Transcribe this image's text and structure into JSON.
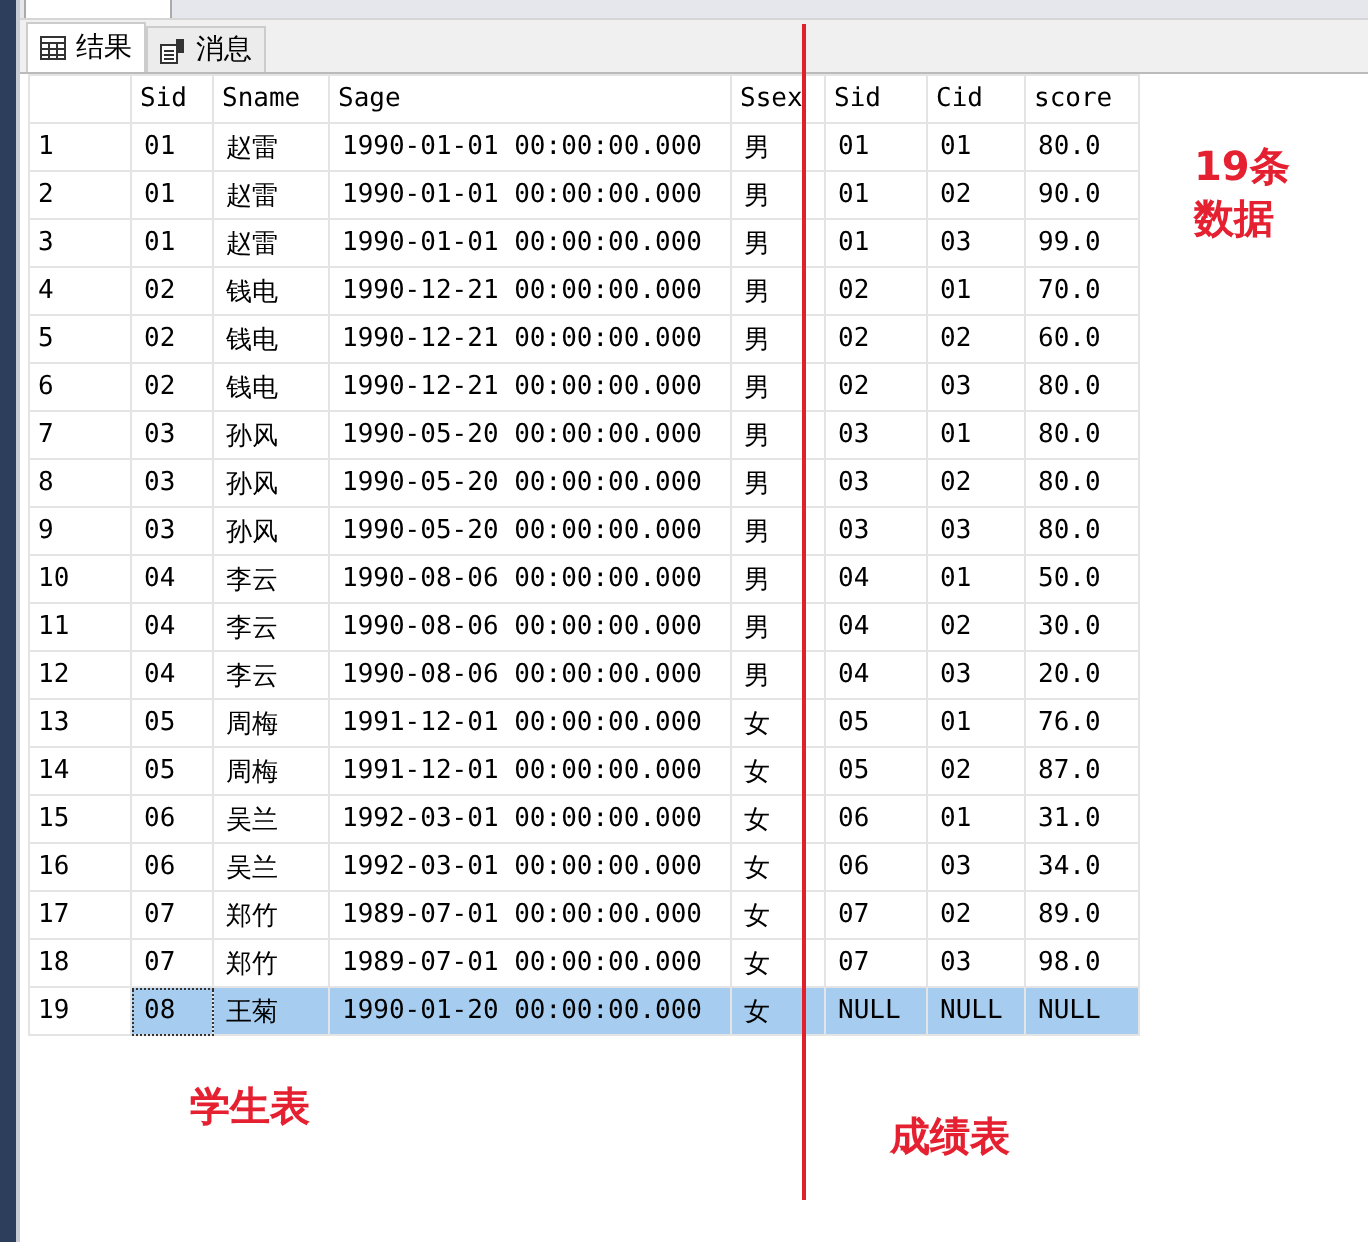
{
  "tabs": [
    {
      "label": "结果",
      "selected": true
    },
    {
      "label": "消息",
      "selected": false
    }
  ],
  "table": {
    "columns": [
      "",
      "Sid",
      "Sname",
      "Sage",
      "Ssex",
      "Sid",
      "Cid",
      "score"
    ],
    "rows": [
      {
        "cells": [
          "1",
          "01",
          "赵雷",
          "1990-01-01 00:00:00.000",
          "男",
          "01",
          "01",
          "80.0"
        ],
        "selected": false
      },
      {
        "cells": [
          "2",
          "01",
          "赵雷",
          "1990-01-01 00:00:00.000",
          "男",
          "01",
          "02",
          "90.0"
        ],
        "selected": false
      },
      {
        "cells": [
          "3",
          "01",
          "赵雷",
          "1990-01-01 00:00:00.000",
          "男",
          "01",
          "03",
          "99.0"
        ],
        "selected": false
      },
      {
        "cells": [
          "4",
          "02",
          "钱电",
          "1990-12-21 00:00:00.000",
          "男",
          "02",
          "01",
          "70.0"
        ],
        "selected": false
      },
      {
        "cells": [
          "5",
          "02",
          "钱电",
          "1990-12-21 00:00:00.000",
          "男",
          "02",
          "02",
          "60.0"
        ],
        "selected": false
      },
      {
        "cells": [
          "6",
          "02",
          "钱电",
          "1990-12-21 00:00:00.000",
          "男",
          "02",
          "03",
          "80.0"
        ],
        "selected": false
      },
      {
        "cells": [
          "7",
          "03",
          "孙风",
          "1990-05-20 00:00:00.000",
          "男",
          "03",
          "01",
          "80.0"
        ],
        "selected": false
      },
      {
        "cells": [
          "8",
          "03",
          "孙风",
          "1990-05-20 00:00:00.000",
          "男",
          "03",
          "02",
          "80.0"
        ],
        "selected": false
      },
      {
        "cells": [
          "9",
          "03",
          "孙风",
          "1990-05-20 00:00:00.000",
          "男",
          "03",
          "03",
          "80.0"
        ],
        "selected": false
      },
      {
        "cells": [
          "10",
          "04",
          "李云",
          "1990-08-06 00:00:00.000",
          "男",
          "04",
          "01",
          "50.0"
        ],
        "selected": false
      },
      {
        "cells": [
          "11",
          "04",
          "李云",
          "1990-08-06 00:00:00.000",
          "男",
          "04",
          "02",
          "30.0"
        ],
        "selected": false
      },
      {
        "cells": [
          "12",
          "04",
          "李云",
          "1990-08-06 00:00:00.000",
          "男",
          "04",
          "03",
          "20.0"
        ],
        "selected": false
      },
      {
        "cells": [
          "13",
          "05",
          "周梅",
          "1991-12-01 00:00:00.000",
          "女",
          "05",
          "01",
          "76.0"
        ],
        "selected": false
      },
      {
        "cells": [
          "14",
          "05",
          "周梅",
          "1991-12-01 00:00:00.000",
          "女",
          "05",
          "02",
          "87.0"
        ],
        "selected": false
      },
      {
        "cells": [
          "15",
          "06",
          "吴兰",
          "1992-03-01 00:00:00.000",
          "女",
          "06",
          "01",
          "31.0"
        ],
        "selected": false
      },
      {
        "cells": [
          "16",
          "06",
          "吴兰",
          "1992-03-01 00:00:00.000",
          "女",
          "06",
          "03",
          "34.0"
        ],
        "selected": false
      },
      {
        "cells": [
          "17",
          "07",
          "郑竹",
          "1989-07-01 00:00:00.000",
          "女",
          "07",
          "02",
          "89.0"
        ],
        "selected": false
      },
      {
        "cells": [
          "18",
          "07",
          "郑竹",
          "1989-07-01 00:00:00.000",
          "女",
          "07",
          "03",
          "98.0"
        ],
        "selected": false
      },
      {
        "cells": [
          "19",
          "08",
          "王菊",
          "1990-01-20 00:00:00.000",
          "女",
          "NULL",
          "NULL",
          "NULL"
        ],
        "selected": true
      }
    ]
  },
  "annotations": [
    {
      "kind": "count",
      "text": "19条数据"
    },
    {
      "kind": "left",
      "text": "学生表"
    },
    {
      "kind": "right",
      "text": "成绩表"
    }
  ]
}
